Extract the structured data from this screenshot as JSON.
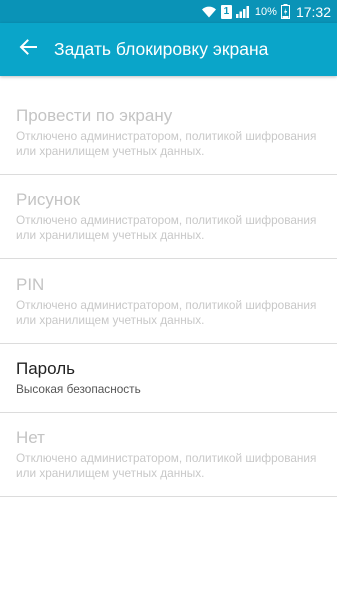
{
  "status_bar": {
    "sim_label": "1",
    "battery_percent": "10%",
    "time": "17:32",
    "icons": [
      "wifi-icon",
      "sim-icon",
      "signal-icon",
      "battery-icon"
    ]
  },
  "app_bar": {
    "back_icon": "arrow-back-icon",
    "title": "Задать блокировку экрана",
    "background": "#0aa5c9"
  },
  "options": [
    {
      "title": "Провести по экрану",
      "subtitle": "Отключено администратором, политикой шифрования или хранилищем учетных данных.",
      "enabled": false
    },
    {
      "title": "Рисунок",
      "subtitle": "Отключено администратором, политикой шифрования или хранилищем учетных данных.",
      "enabled": false
    },
    {
      "title": "PIN",
      "subtitle": "Отключено администратором, политикой шифрования или хранилищем учетных данных.",
      "enabled": false
    },
    {
      "title": "Пароль",
      "subtitle": "Высокая безопасность",
      "enabled": true
    },
    {
      "title": "Нет",
      "subtitle": "Отключено администратором, политикой шифрования или хранилищем учетных данных.",
      "enabled": false
    }
  ]
}
